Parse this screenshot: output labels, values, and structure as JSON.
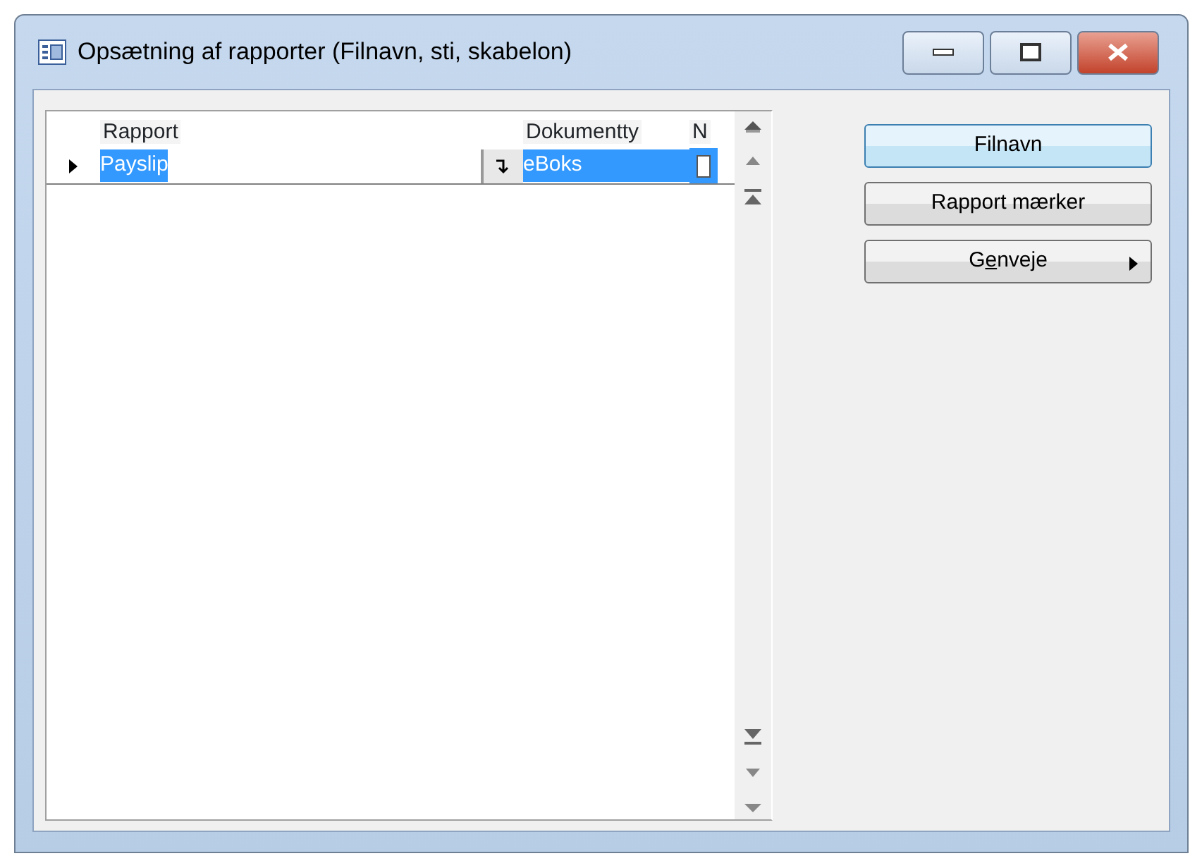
{
  "window": {
    "title": "Opsætning af rapporter (Filnavn, sti, skabelon)"
  },
  "table": {
    "columns": [
      "Rapport",
      "Dokumentty",
      "N"
    ],
    "rows": [
      {
        "current": true,
        "cells": [
          {
            "text": "Payslip",
            "selected": true
          },
          {
            "text": "eBoks",
            "selected": true
          }
        ]
      }
    ]
  },
  "buttons": [
    {
      "label": "Filnavn",
      "default": true,
      "submenu": false
    },
    {
      "label": "Rapport mærker",
      "default": false,
      "submenu": false
    },
    {
      "label_parts": [
        {
          "text": "G",
          "underlined": false
        },
        {
          "text": "e",
          "underlined": true
        },
        {
          "text": "nveje",
          "underlined": false
        }
      ],
      "default": false,
      "submenu": true
    }
  ]
}
